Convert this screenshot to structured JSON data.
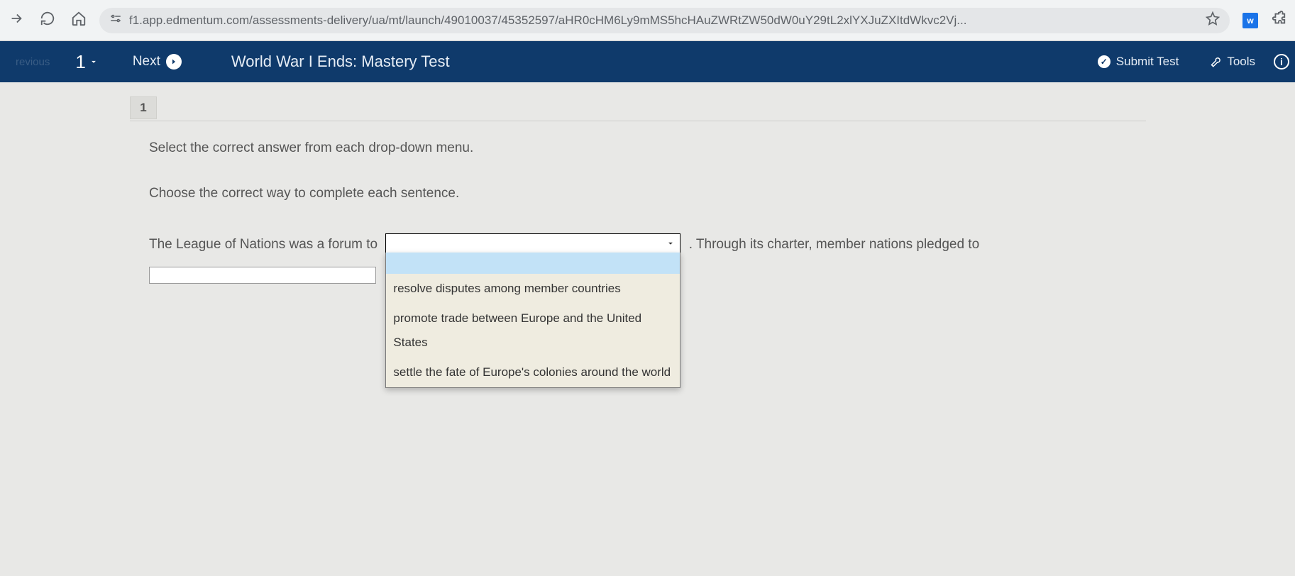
{
  "browser": {
    "url": "f1.app.edmentum.com/assessments-delivery/ua/mt/launch/49010037/45352597/aHR0cHM6Ly9mMS5hcHAuZWRtZW50dW0uY29tL2xlYXJuZXItdWkvc2Vj..."
  },
  "header": {
    "previous_label": "revious",
    "question_number": "1",
    "next_label": "Next",
    "title": "World War I Ends: Mastery Test",
    "submit_label": "Submit Test",
    "tools_label": "Tools"
  },
  "question": {
    "tab_label": "1",
    "instruction": "Select the correct answer from each drop-down menu.",
    "subinstruction": "Choose the correct way to complete each sentence.",
    "sentence_part1": "The League of Nations was a forum to ",
    "sentence_part2": " . Through its charter, member nations pledged to",
    "dropdown1": {
      "selected": "",
      "options": [
        "",
        "resolve disputes among member countries",
        "promote trade between Europe and the United States",
        "settle the fate of Europe's colonies around the world"
      ]
    },
    "dropdown2": {
      "selected": ""
    }
  }
}
